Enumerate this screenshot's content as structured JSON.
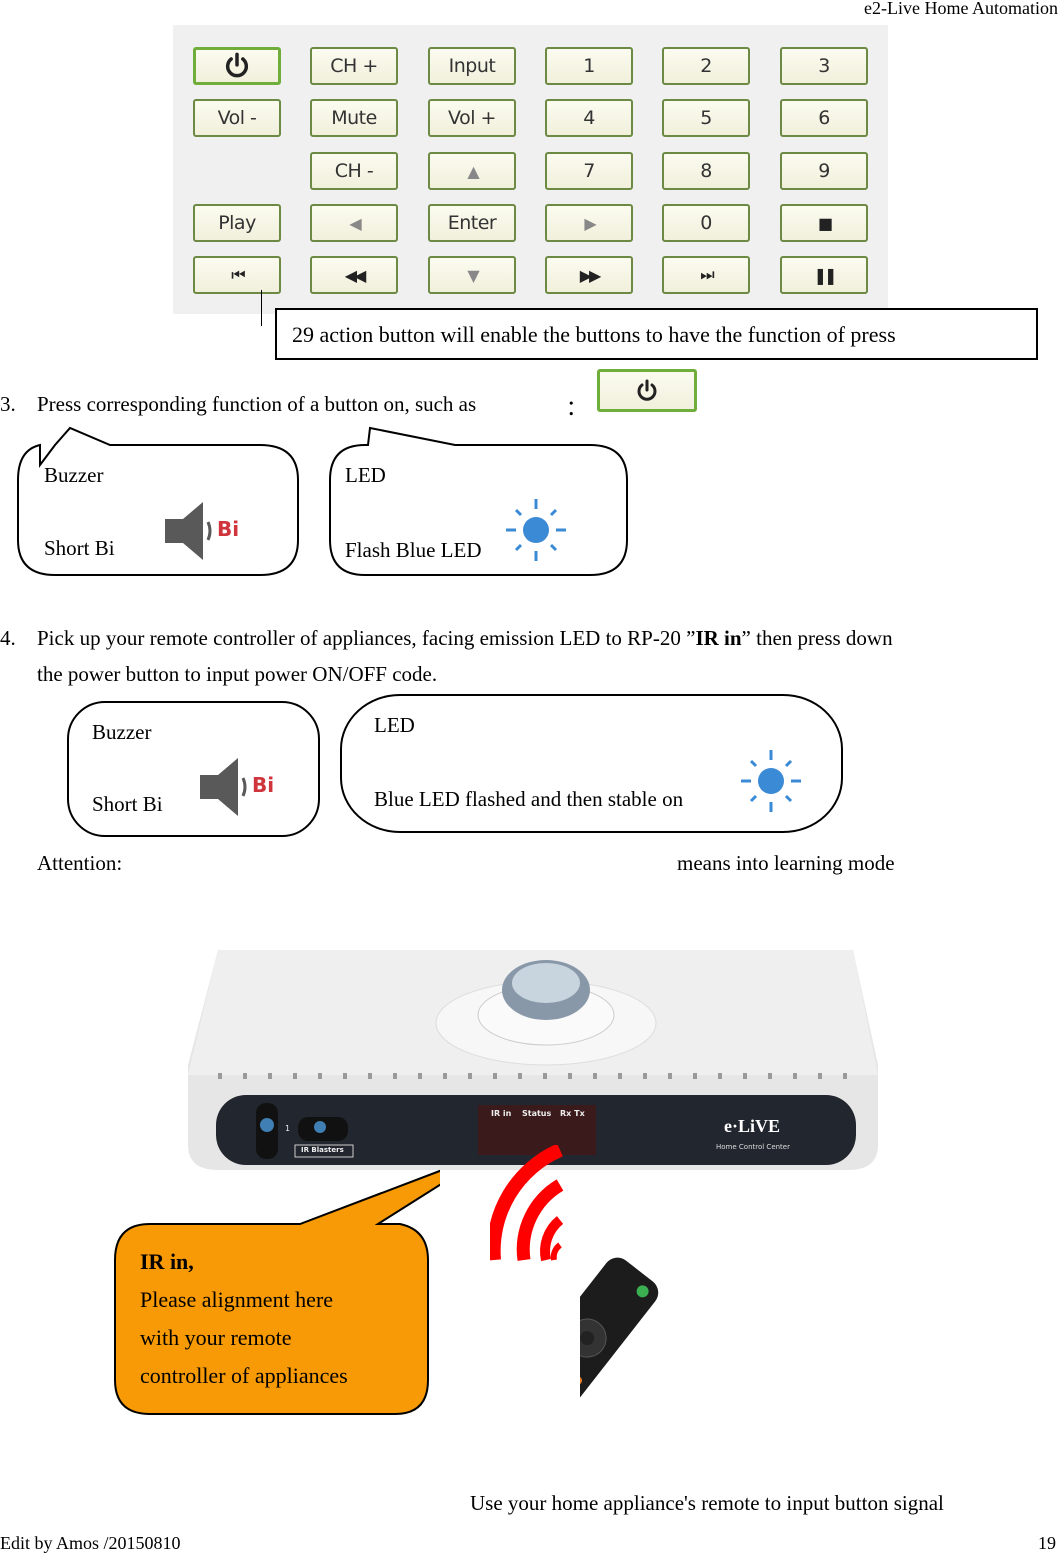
{
  "header": {
    "title": "e2-Live Home Automation"
  },
  "remote_panel": {
    "buttons": [
      {
        "label": "",
        "icon": "power-icon",
        "name": "power"
      },
      {
        "label": "CH +",
        "name": "ch-up"
      },
      {
        "label": "Input",
        "name": "input"
      },
      {
        "label": "1",
        "name": "1"
      },
      {
        "label": "2",
        "name": "2"
      },
      {
        "label": "3",
        "name": "3"
      },
      {
        "label": "Vol -",
        "name": "vol-down"
      },
      {
        "label": "Mute",
        "name": "mute"
      },
      {
        "label": "Vol +",
        "name": "vol-up"
      },
      {
        "label": "4",
        "name": "4"
      },
      {
        "label": "5",
        "name": "5"
      },
      {
        "label": "6",
        "name": "6"
      },
      {
        "label": "CH -",
        "name": "ch-down"
      },
      {
        "label": "▲",
        "icon": "arrow-up-icon",
        "name": "up"
      },
      {
        "label": "7",
        "name": "7"
      },
      {
        "label": "8",
        "name": "8"
      },
      {
        "label": "9",
        "name": "9"
      },
      {
        "label": "Play",
        "name": "play"
      },
      {
        "label": "◀",
        "icon": "arrow-left-icon",
        "name": "left"
      },
      {
        "label": "Enter",
        "name": "enter"
      },
      {
        "label": "▶",
        "icon": "arrow-right-icon",
        "name": "right"
      },
      {
        "label": "0",
        "name": "0"
      },
      {
        "label": "■",
        "icon": "stop-icon",
        "name": "stop"
      },
      {
        "label": "⏮",
        "icon": "skip-back-icon",
        "name": "prev"
      },
      {
        "label": "◀◀",
        "icon": "rewind-icon",
        "name": "rewind"
      },
      {
        "label": "▼",
        "icon": "arrow-down-icon",
        "name": "down"
      },
      {
        "label": "▶▶",
        "icon": "fast-forward-icon",
        "name": "fast-forward"
      },
      {
        "label": "⏭",
        "icon": "skip-forward-icon",
        "name": "next"
      },
      {
        "label": "❚❚",
        "icon": "pause-icon",
        "name": "pause"
      }
    ],
    "callout": "29 action button will enable the buttons to have the function of press"
  },
  "step3": {
    "number": "3.",
    "text": "Press corresponding function of a button on, such as",
    "colon": "：",
    "buzzer": {
      "title": "Buzzer",
      "desc": "Short Bi",
      "sound": "Bi"
    },
    "led": {
      "title": "LED",
      "desc": "Flash Blue LED"
    }
  },
  "step4": {
    "number": "4.",
    "text_a": "Pick up your remote controller of appliances, facing emission LED to RP-20 ”",
    "text_bold": "IR in",
    "text_b": "” then press down",
    "text_line2": "the power button to input power ON/OFF code.",
    "buzzer": {
      "title": "Buzzer",
      "desc": "Short Bi",
      "sound": "Bi"
    },
    "led": {
      "title": "LED",
      "desc": "Blue LED flashed and then stable on"
    },
    "attention_label": "Attention:",
    "attention_text": "means into learning mode"
  },
  "device": {
    "labels": {
      "ir_in": "IR in",
      "status": "Status",
      "rxtx": "Rx Tx",
      "blasters": "IR Blasters",
      "brand": "e·LiVE",
      "brand_sub": "Home Control Center",
      "port": "1"
    },
    "callout": {
      "title": "IR in,",
      "lines": [
        "Please alignment here",
        "with your remote",
        "controller of appliances"
      ]
    },
    "caption": "Use your home appliance's remote to input button signal"
  },
  "footer": {
    "editor": "Edit by Amos /20150810",
    "page": "19"
  }
}
